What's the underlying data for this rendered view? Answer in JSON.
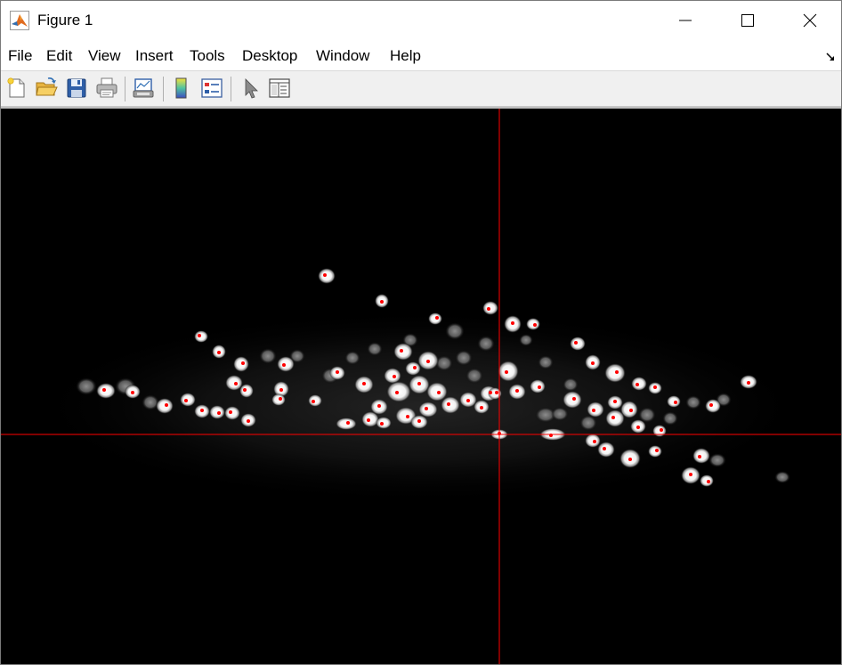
{
  "window": {
    "title": "Figure 1",
    "icon": "matlab-logo-icon",
    "controls": [
      "minimize-icon",
      "maximize-icon",
      "close-icon"
    ]
  },
  "menu": {
    "items": [
      "File",
      "Edit",
      "View",
      "Insert",
      "Tools",
      "Desktop",
      "Window",
      "Help"
    ]
  },
  "toolbar": {
    "buttons": [
      "new-figure-icon",
      "open-file-icon",
      "save-icon",
      "print-icon",
      "link-plot-icon",
      "insert-colorbar-icon",
      "insert-legend-icon",
      "edit-plot-arrow-icon",
      "property-inspector-icon"
    ]
  },
  "figure": {
    "colors": {
      "background": "#000000",
      "marker": "#ff0000",
      "crosshair": "#ff0000",
      "cell": "#ffffff"
    }
  }
}
